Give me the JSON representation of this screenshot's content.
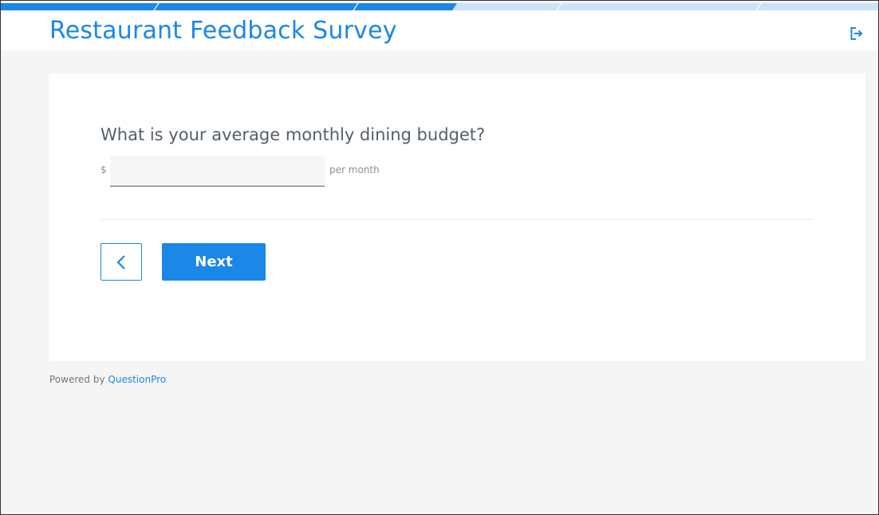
{
  "survey": {
    "title": "Restaurant Feedback Survey",
    "progress": 0.52
  },
  "header": {
    "exit_icon": "exit-icon"
  },
  "question": {
    "text": "What is your average monthly dining budget?",
    "currency_symbol": "$",
    "input_value": "",
    "input_placeholder": "",
    "unit_suffix": "per month"
  },
  "navigation": {
    "back_icon": "chevron-left-icon",
    "next_label": "Next"
  },
  "footer": {
    "powered_by_label": "Powered by",
    "brand_link": "QuestionPro"
  },
  "colors": {
    "accent": "#1b87e6",
    "progress_track": "#c9e3fa",
    "text_dark": "#545e6b",
    "page_bg": "#f5f5f5"
  }
}
